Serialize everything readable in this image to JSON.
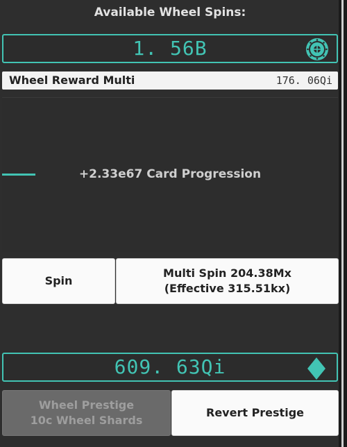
{
  "header": {
    "title": "Available Wheel Spins:"
  },
  "spins": {
    "value": "1. 56B",
    "icon": "wheel-icon"
  },
  "reward_multi": {
    "label": "Wheel Reward Multi",
    "value": "176. 06Qi"
  },
  "progress": {
    "text": "+2.33e67 Card Progression",
    "fill_fraction": 0.1
  },
  "buttons": {
    "spin": "Spin",
    "multi_spin_line1": "Multi Spin 204.38Mx",
    "multi_spin_line2": "(Effective 315.51kx)",
    "prestige_line1": "Wheel Prestige",
    "prestige_line2": "10c Wheel Shards",
    "revert": "Revert Prestige"
  },
  "shards": {
    "value": "609. 63Qi",
    "icon": "diamond-icon"
  },
  "colors": {
    "accent": "#42c4b4",
    "background": "#2e2e2e",
    "button_bg": "#fafafa",
    "disabled_bg": "#6a6a6a"
  }
}
